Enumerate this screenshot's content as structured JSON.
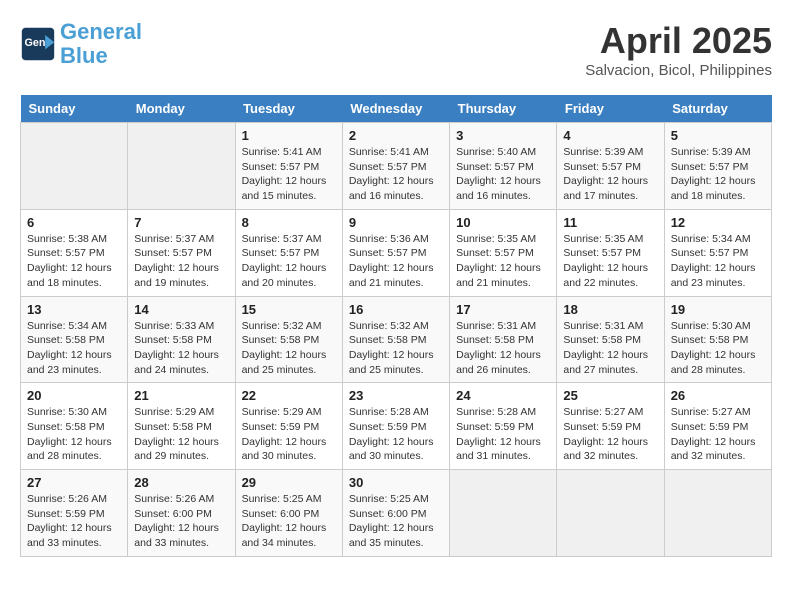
{
  "header": {
    "logo_line1": "General",
    "logo_line2": "Blue",
    "month": "April 2025",
    "location": "Salvacion, Bicol, Philippines"
  },
  "weekdays": [
    "Sunday",
    "Monday",
    "Tuesday",
    "Wednesday",
    "Thursday",
    "Friday",
    "Saturday"
  ],
  "weeks": [
    [
      {
        "day": "",
        "info": ""
      },
      {
        "day": "",
        "info": ""
      },
      {
        "day": "1",
        "info": "Sunrise: 5:41 AM\nSunset: 5:57 PM\nDaylight: 12 hours and 15 minutes."
      },
      {
        "day": "2",
        "info": "Sunrise: 5:41 AM\nSunset: 5:57 PM\nDaylight: 12 hours and 16 minutes."
      },
      {
        "day": "3",
        "info": "Sunrise: 5:40 AM\nSunset: 5:57 PM\nDaylight: 12 hours and 16 minutes."
      },
      {
        "day": "4",
        "info": "Sunrise: 5:39 AM\nSunset: 5:57 PM\nDaylight: 12 hours and 17 minutes."
      },
      {
        "day": "5",
        "info": "Sunrise: 5:39 AM\nSunset: 5:57 PM\nDaylight: 12 hours and 18 minutes."
      }
    ],
    [
      {
        "day": "6",
        "info": "Sunrise: 5:38 AM\nSunset: 5:57 PM\nDaylight: 12 hours and 18 minutes."
      },
      {
        "day": "7",
        "info": "Sunrise: 5:37 AM\nSunset: 5:57 PM\nDaylight: 12 hours and 19 minutes."
      },
      {
        "day": "8",
        "info": "Sunrise: 5:37 AM\nSunset: 5:57 PM\nDaylight: 12 hours and 20 minutes."
      },
      {
        "day": "9",
        "info": "Sunrise: 5:36 AM\nSunset: 5:57 PM\nDaylight: 12 hours and 21 minutes."
      },
      {
        "day": "10",
        "info": "Sunrise: 5:35 AM\nSunset: 5:57 PM\nDaylight: 12 hours and 21 minutes."
      },
      {
        "day": "11",
        "info": "Sunrise: 5:35 AM\nSunset: 5:57 PM\nDaylight: 12 hours and 22 minutes."
      },
      {
        "day": "12",
        "info": "Sunrise: 5:34 AM\nSunset: 5:57 PM\nDaylight: 12 hours and 23 minutes."
      }
    ],
    [
      {
        "day": "13",
        "info": "Sunrise: 5:34 AM\nSunset: 5:58 PM\nDaylight: 12 hours and 23 minutes."
      },
      {
        "day": "14",
        "info": "Sunrise: 5:33 AM\nSunset: 5:58 PM\nDaylight: 12 hours and 24 minutes."
      },
      {
        "day": "15",
        "info": "Sunrise: 5:32 AM\nSunset: 5:58 PM\nDaylight: 12 hours and 25 minutes."
      },
      {
        "day": "16",
        "info": "Sunrise: 5:32 AM\nSunset: 5:58 PM\nDaylight: 12 hours and 25 minutes."
      },
      {
        "day": "17",
        "info": "Sunrise: 5:31 AM\nSunset: 5:58 PM\nDaylight: 12 hours and 26 minutes."
      },
      {
        "day": "18",
        "info": "Sunrise: 5:31 AM\nSunset: 5:58 PM\nDaylight: 12 hours and 27 minutes."
      },
      {
        "day": "19",
        "info": "Sunrise: 5:30 AM\nSunset: 5:58 PM\nDaylight: 12 hours and 28 minutes."
      }
    ],
    [
      {
        "day": "20",
        "info": "Sunrise: 5:30 AM\nSunset: 5:58 PM\nDaylight: 12 hours and 28 minutes."
      },
      {
        "day": "21",
        "info": "Sunrise: 5:29 AM\nSunset: 5:58 PM\nDaylight: 12 hours and 29 minutes."
      },
      {
        "day": "22",
        "info": "Sunrise: 5:29 AM\nSunset: 5:59 PM\nDaylight: 12 hours and 30 minutes."
      },
      {
        "day": "23",
        "info": "Sunrise: 5:28 AM\nSunset: 5:59 PM\nDaylight: 12 hours and 30 minutes."
      },
      {
        "day": "24",
        "info": "Sunrise: 5:28 AM\nSunset: 5:59 PM\nDaylight: 12 hours and 31 minutes."
      },
      {
        "day": "25",
        "info": "Sunrise: 5:27 AM\nSunset: 5:59 PM\nDaylight: 12 hours and 32 minutes."
      },
      {
        "day": "26",
        "info": "Sunrise: 5:27 AM\nSunset: 5:59 PM\nDaylight: 12 hours and 32 minutes."
      }
    ],
    [
      {
        "day": "27",
        "info": "Sunrise: 5:26 AM\nSunset: 5:59 PM\nDaylight: 12 hours and 33 minutes."
      },
      {
        "day": "28",
        "info": "Sunrise: 5:26 AM\nSunset: 6:00 PM\nDaylight: 12 hours and 33 minutes."
      },
      {
        "day": "29",
        "info": "Sunrise: 5:25 AM\nSunset: 6:00 PM\nDaylight: 12 hours and 34 minutes."
      },
      {
        "day": "30",
        "info": "Sunrise: 5:25 AM\nSunset: 6:00 PM\nDaylight: 12 hours and 35 minutes."
      },
      {
        "day": "",
        "info": ""
      },
      {
        "day": "",
        "info": ""
      },
      {
        "day": "",
        "info": ""
      }
    ]
  ]
}
